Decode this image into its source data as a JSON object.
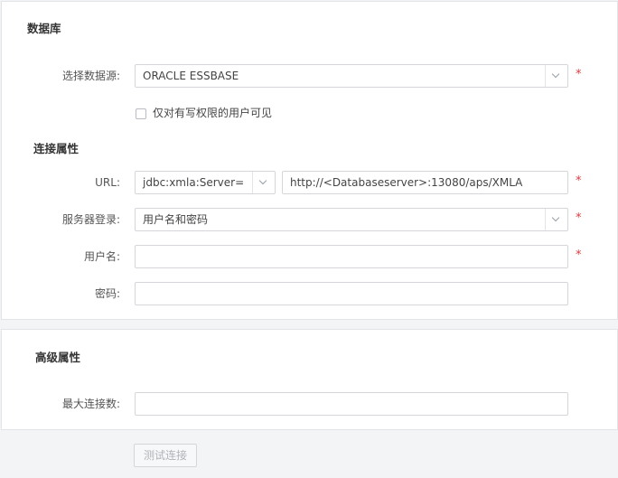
{
  "database": {
    "title": "数据库",
    "datasource": {
      "label": "选择数据源:",
      "value": "ORACLE ESSBASE"
    },
    "visibility_checkbox": {
      "label": "仅对有写权限的用户可见",
      "checked": false
    }
  },
  "connection": {
    "title": "连接属性",
    "url": {
      "label": "URL:",
      "prefix": "jdbc:xmla:Server=",
      "value": "http://<Databaseserver>:13080/aps/XMLA"
    },
    "server_login": {
      "label": "服务器登录:",
      "value": "用户名和密码"
    },
    "username": {
      "label": "用户名:",
      "value": ""
    },
    "password": {
      "label": "密码:",
      "value": ""
    }
  },
  "advanced": {
    "title": "高级属性",
    "max_connections": {
      "label": "最大连接数:",
      "value": ""
    }
  },
  "test_button": {
    "label": "测试连接",
    "disabled": true
  },
  "required_marker": "*",
  "colors": {
    "required": "#e0393e",
    "border": "#d4d6da",
    "background": "#f3f4f6",
    "panel": "#ffffff"
  }
}
